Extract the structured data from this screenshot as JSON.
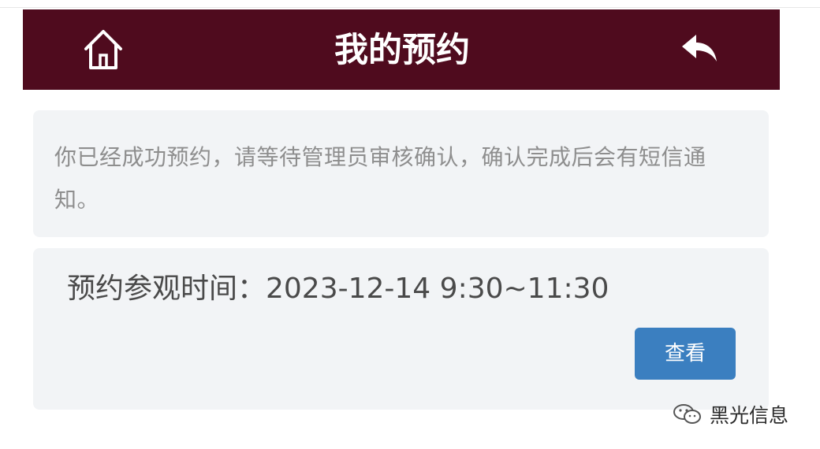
{
  "header": {
    "title": "我的预约",
    "home_icon": "home-icon",
    "back_icon": "reply-arrow-icon",
    "background_color": "#4f0b1e"
  },
  "notice": {
    "text": "你已经成功预约，请等待管理员审核确认，确认完成后会有短信通知。"
  },
  "visit": {
    "time_label": "预约参观时间：2023-12-14 9:30~11:30",
    "view_button_label": "查看",
    "button_color": "#3b7fc0"
  },
  "watermark": {
    "icon": "wechat-icon",
    "text": "黑光信息"
  }
}
